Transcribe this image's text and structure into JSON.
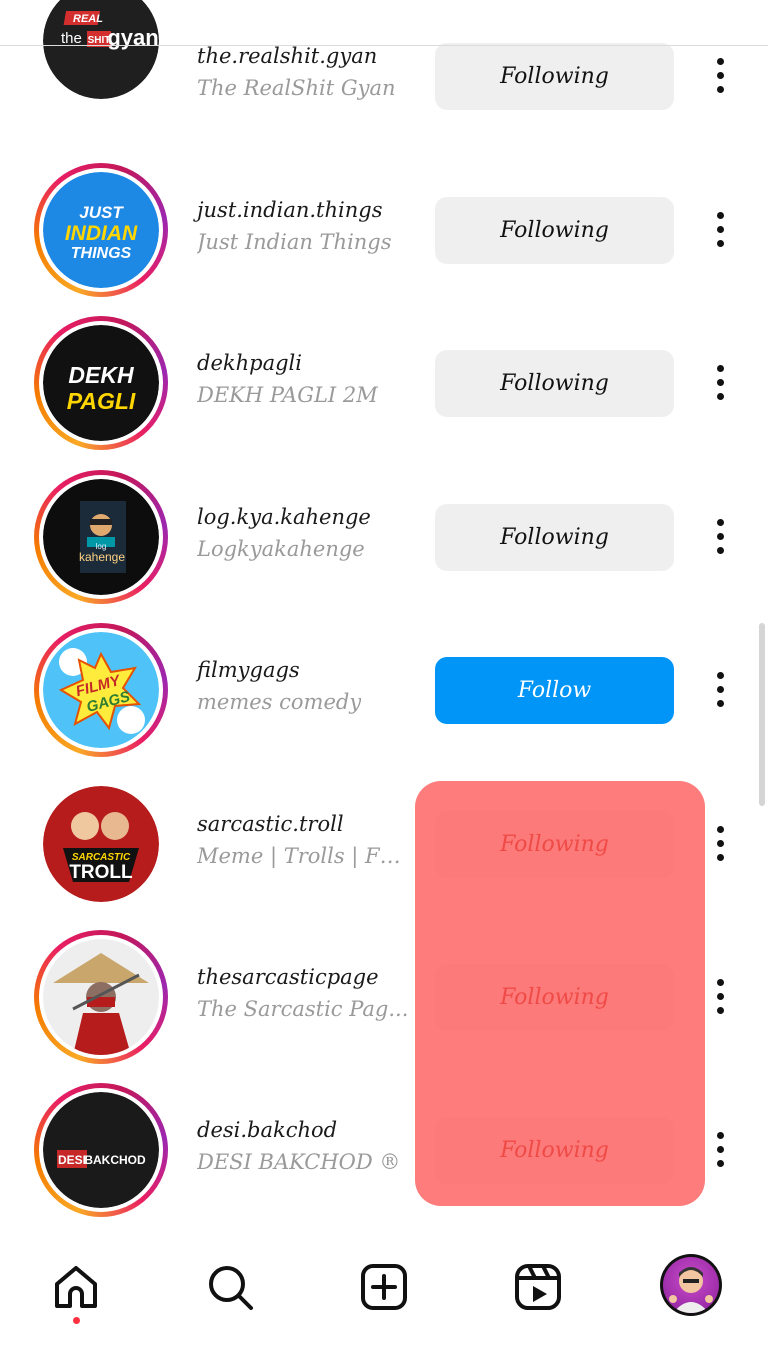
{
  "accounts": [
    {
      "username": "the.realshit.gyan",
      "full_name": "The RealShit Gyan",
      "button": "Following",
      "button_style": "following",
      "avatar_text": [
        "REAL",
        "the",
        "SHIT",
        "gyan"
      ]
    },
    {
      "username": "just.indian.things",
      "full_name": "Just Indian Things",
      "button": "Following",
      "button_style": "following",
      "avatar_text": [
        "JUST",
        "INDIAN",
        "THINGS"
      ]
    },
    {
      "username": "dekhpagli",
      "full_name": "DEKH PAGLI 2M",
      "button": "Following",
      "button_style": "following",
      "avatar_text": [
        "DEKH",
        "PAGLI"
      ]
    },
    {
      "username": "log.kya.kahenge",
      "full_name": "Logkyakahenge",
      "button": "Following",
      "button_style": "following",
      "avatar_text": [
        "log",
        "kahenge"
      ]
    },
    {
      "username": "filmygags",
      "full_name": "memes comedy",
      "button": "Follow",
      "button_style": "follow",
      "avatar_text": [
        "FILMY",
        "GAGS"
      ]
    },
    {
      "username": "sarcastic.troll",
      "full_name": "Meme | Trolls | Fri...",
      "button": "Following",
      "button_style": "dim",
      "avatar_text": [
        "SARCASTIC",
        "TROLL"
      ]
    },
    {
      "username": "thesarcasticpage",
      "full_name": "The Sarcastic Pag...",
      "button": "Following",
      "button_style": "dim",
      "avatar_text": []
    },
    {
      "username": "desi.bakchod",
      "full_name": "DESI BAKCHOD ®",
      "button": "Following",
      "button_style": "dim",
      "avatar_text": [
        "DESI",
        "BAKCHOD"
      ]
    }
  ],
  "colors": {
    "follow_blue": "#0095f6",
    "following_gray": "#efefef",
    "highlight_red": "#ff5050",
    "notification_dot": "#ff3040"
  },
  "bottom_nav": [
    {
      "icon": "home-icon"
    },
    {
      "icon": "search-icon"
    },
    {
      "icon": "new-post-icon"
    },
    {
      "icon": "reels-icon"
    },
    {
      "icon": "profile-avatar"
    }
  ]
}
